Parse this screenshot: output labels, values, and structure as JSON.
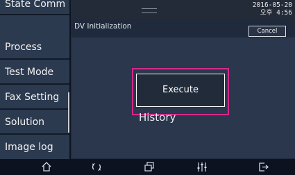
{
  "status_bar": {
    "date": "2016-05-20",
    "time": "오후 4:56"
  },
  "sidebar": {
    "items": [
      {
        "label": "State Comm"
      },
      {
        "label": "Process"
      },
      {
        "label": "Test Mode"
      },
      {
        "label": "Fax Setting"
      },
      {
        "label": "Solution"
      },
      {
        "label": "Image log"
      }
    ]
  },
  "main": {
    "title": "DV Initialization",
    "cancel_label": "Cancel",
    "execute_label": "Execute",
    "history_label": "History"
  },
  "nav": {
    "icons": [
      "home-icon",
      "refresh-icon",
      "windows-icon",
      "settings-sliders-icon",
      "exit-icon"
    ]
  },
  "colors": {
    "highlight": "#d6288a",
    "background": "#1f2a3c",
    "sidebar": "#2c3a50"
  }
}
